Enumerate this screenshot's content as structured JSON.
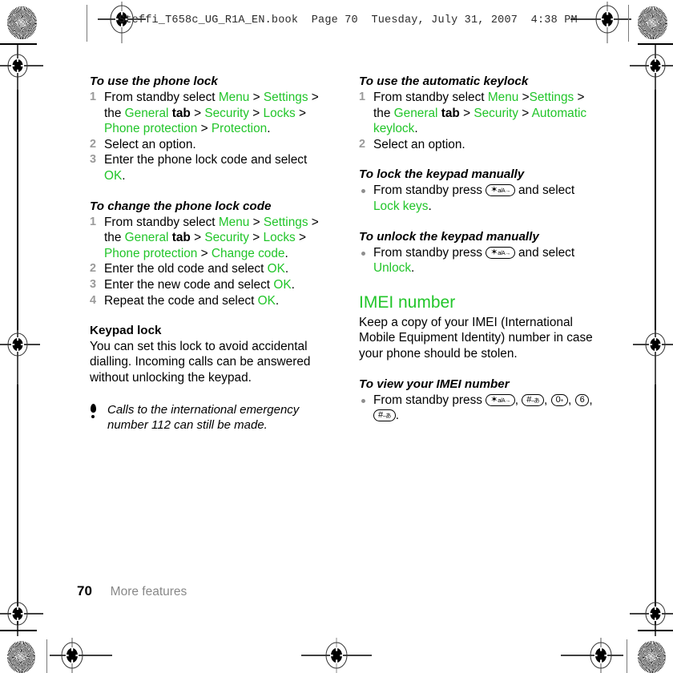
{
  "header": {
    "printer_line": "Steffi_T658c_UG_R1A_EN.book  Page 70  Tuesday, July 31, 2007  4:38 PM"
  },
  "left_column": {
    "section_1": {
      "heading": "To use the phone lock",
      "steps": [
        {
          "parts": [
            {
              "t": "From standby select ",
              "s": "plain"
            },
            {
              "t": "Menu",
              "s": "link"
            },
            {
              "t": " > ",
              "s": "plain"
            },
            {
              "t": "Settings",
              "s": "link"
            },
            {
              "t": " > the ",
              "s": "plain"
            },
            {
              "t": "General",
              "s": "link"
            },
            {
              "t": " tab",
              "s": "bold"
            },
            {
              "t": " > ",
              "s": "plain"
            },
            {
              "t": "Security",
              "s": "link"
            },
            {
              "t": " > ",
              "s": "plain"
            },
            {
              "t": "Locks",
              "s": "link"
            },
            {
              "t": " > ",
              "s": "plain"
            },
            {
              "t": "Phone protection",
              "s": "link"
            },
            {
              "t": " > ",
              "s": "plain"
            },
            {
              "t": "Protection",
              "s": "link"
            },
            {
              "t": ".",
              "s": "plain"
            }
          ]
        },
        {
          "parts": [
            {
              "t": "Select an option.",
              "s": "plain"
            }
          ]
        },
        {
          "parts": [
            {
              "t": "Enter the phone lock code and select ",
              "s": "plain"
            },
            {
              "t": "OK",
              "s": "link"
            },
            {
              "t": ".",
              "s": "plain"
            }
          ]
        }
      ]
    },
    "section_2": {
      "heading": "To change the phone lock code",
      "steps": [
        {
          "parts": [
            {
              "t": "From standby select ",
              "s": "plain"
            },
            {
              "t": "Menu",
              "s": "link"
            },
            {
              "t": " > ",
              "s": "plain"
            },
            {
              "t": "Settings",
              "s": "link"
            },
            {
              "t": " > the ",
              "s": "plain"
            },
            {
              "t": "General",
              "s": "link"
            },
            {
              "t": " tab",
              "s": "bold"
            },
            {
              "t": " > ",
              "s": "plain"
            },
            {
              "t": "Security",
              "s": "link"
            },
            {
              "t": " > ",
              "s": "plain"
            },
            {
              "t": "Locks",
              "s": "link"
            },
            {
              "t": " > ",
              "s": "plain"
            },
            {
              "t": "Phone protection",
              "s": "link"
            },
            {
              "t": " > ",
              "s": "plain"
            },
            {
              "t": "Change code",
              "s": "link"
            },
            {
              "t": ".",
              "s": "plain"
            }
          ]
        },
        {
          "parts": [
            {
              "t": "Enter the old code and select ",
              "s": "plain"
            },
            {
              "t": "OK",
              "s": "link"
            },
            {
              "t": ".",
              "s": "plain"
            }
          ]
        },
        {
          "parts": [
            {
              "t": "Enter the new code and select ",
              "s": "plain"
            },
            {
              "t": "OK",
              "s": "link"
            },
            {
              "t": ".",
              "s": "plain"
            }
          ]
        },
        {
          "parts": [
            {
              "t": "Repeat the code and select ",
              "s": "plain"
            },
            {
              "t": "OK",
              "s": "link"
            },
            {
              "t": ".",
              "s": "plain"
            }
          ]
        }
      ]
    },
    "keypad_lock": {
      "heading": "Keypad lock",
      "body": "You can set this lock to avoid accidental dialling. Incoming calls can be answered without unlocking the keypad."
    },
    "note": {
      "icon": "exclamation-note-icon",
      "text": "Calls to the international emergency number 112 can still be made."
    }
  },
  "right_column": {
    "section_1": {
      "heading": "To use the automatic keylock",
      "steps": [
        {
          "parts": [
            {
              "t": "From standby select ",
              "s": "plain"
            },
            {
              "t": "Menu",
              "s": "link"
            },
            {
              "t": " >",
              "s": "plain"
            },
            {
              "t": "Settings",
              "s": "link"
            },
            {
              "t": " > the ",
              "s": "plain"
            },
            {
              "t": "General",
              "s": "link"
            },
            {
              "t": " tab",
              "s": "bold"
            },
            {
              "t": " > ",
              "s": "plain"
            },
            {
              "t": "Security",
              "s": "link"
            },
            {
              "t": " > ",
              "s": "plain"
            },
            {
              "t": "Automatic keylock",
              "s": "link"
            },
            {
              "t": ".",
              "s": "plain"
            }
          ]
        },
        {
          "parts": [
            {
              "t": "Select an option.",
              "s": "plain"
            }
          ]
        }
      ]
    },
    "section_2": {
      "heading": "To lock the keypad manually",
      "bullets": [
        {
          "parts": [
            {
              "t": "From standby press ",
              "s": "plain"
            },
            {
              "t": "",
              "s": "key",
              "key": "star"
            },
            {
              "t": " and select ",
              "s": "plain"
            },
            {
              "t": "Lock keys",
              "s": "link"
            },
            {
              "t": ".",
              "s": "plain"
            }
          ]
        }
      ]
    },
    "section_3": {
      "heading": "To unlock the keypad manually",
      "bullets": [
        {
          "parts": [
            {
              "t": "From standby press ",
              "s": "plain"
            },
            {
              "t": "",
              "s": "key",
              "key": "star"
            },
            {
              "t": " and select ",
              "s": "plain"
            },
            {
              "t": "Unlock",
              "s": "link"
            },
            {
              "t": ".",
              "s": "plain"
            }
          ]
        }
      ]
    },
    "imei": {
      "heading": "IMEI number",
      "body": "Keep a copy of your IMEI (International Mobile Equipment Identity) number in case your phone should be stolen."
    },
    "section_4": {
      "heading": "To view your IMEI number",
      "bullets": [
        {
          "parts": [
            {
              "t": "From standby press ",
              "s": "plain"
            },
            {
              "t": "",
              "s": "key",
              "key": "star"
            },
            {
              "t": ", ",
              "s": "plain"
            },
            {
              "t": "",
              "s": "key",
              "key": "hash"
            },
            {
              "t": ", ",
              "s": "plain"
            },
            {
              "t": "",
              "s": "key",
              "key": "zero"
            },
            {
              "t": ", ",
              "s": "plain"
            },
            {
              "t": "",
              "s": "key",
              "key": "six"
            },
            {
              "t": ", ",
              "s": "plain"
            },
            {
              "t": "",
              "s": "key",
              "key": "hash"
            },
            {
              "t": ".",
              "s": "plain"
            }
          ]
        }
      ]
    }
  },
  "keys": {
    "star": {
      "main": "✶",
      "sub": "a/A→",
      "name": "star-key"
    },
    "hash": {
      "main": "#",
      "sub": "–あ",
      "name": "hash-key"
    },
    "zero": {
      "main": "0",
      "sub": "+",
      "name": "zero-key"
    },
    "six": {
      "main": "6",
      "sub": "",
      "name": "six-key"
    }
  },
  "footer": {
    "page_number": "70",
    "chapter": "More features"
  },
  "colors": {
    "accent_green": "#22c52a",
    "muted_gray": "#9a9a9a",
    "footer_gray": "#888888"
  }
}
